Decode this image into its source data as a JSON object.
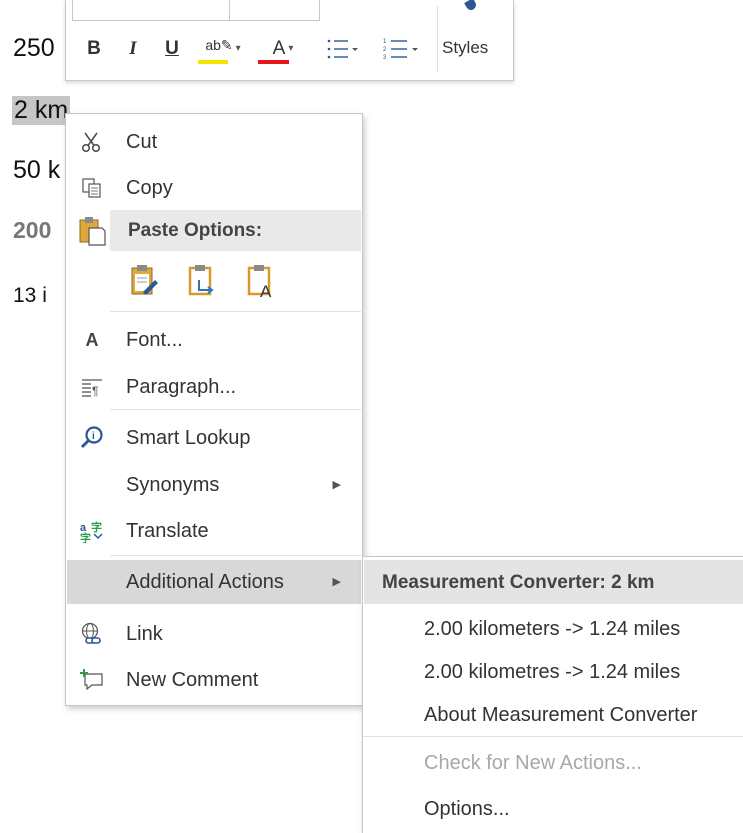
{
  "document": {
    "lines": [
      "250",
      "2 km",
      "50 k",
      "200",
      "13 i"
    ]
  },
  "toolbar": {
    "bold": "B",
    "italic": "I",
    "underline": "U",
    "highlight_glyph": "ab",
    "font_color_glyph": "A",
    "styles_label": "Styles",
    "highlight_color": "#f5e400",
    "font_color": "#e8141c"
  },
  "context_menu": {
    "cut": "Cut",
    "copy": "Copy",
    "paste_options": "Paste Options:",
    "font": "Font...",
    "paragraph": "Paragraph...",
    "smart_lookup": "Smart Lookup",
    "synonyms": "Synonyms",
    "translate": "Translate",
    "additional_actions": "Additional Actions",
    "link": "Link",
    "new_comment": "New Comment"
  },
  "submenu": {
    "header": "Measurement Converter: 2 km",
    "items": [
      "2.00 kilometers -> 1.24 miles",
      "2.00 kilometres -> 1.24 miles",
      "About Measurement Converter"
    ],
    "check_new": "Check for New Actions...",
    "options": "Options..."
  },
  "colors": {
    "accent_blue": "#2b5797",
    "menu_highlight": "#d8d8d8",
    "selection": "#c6c6c6"
  }
}
